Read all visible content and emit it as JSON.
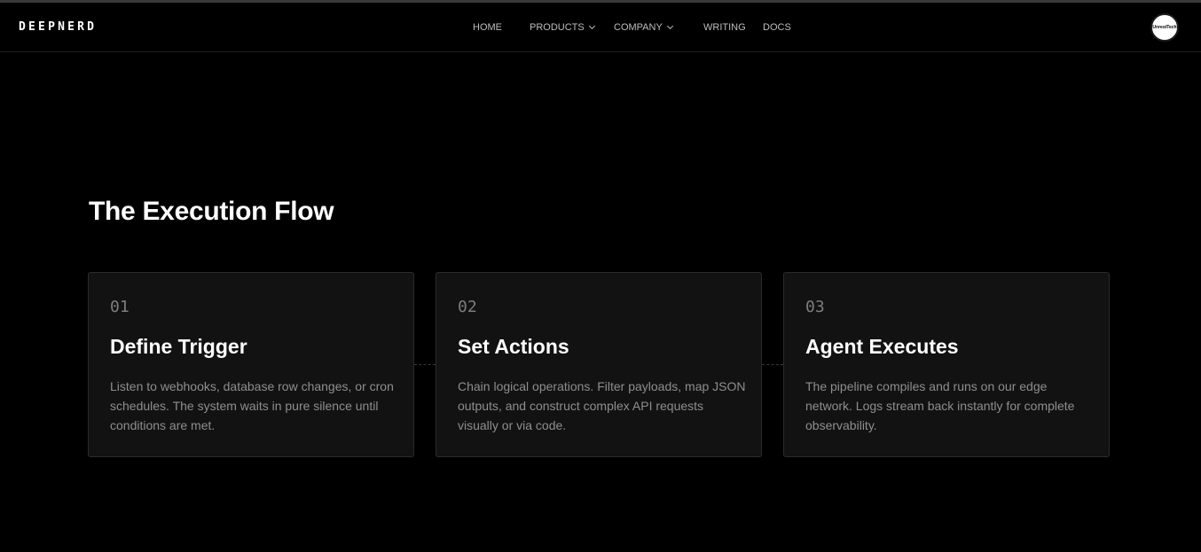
{
  "header": {
    "brand": "DEEPNERD",
    "nav": [
      {
        "label": "HOME",
        "has_dropdown": false
      },
      {
        "label": "PRODUCTS",
        "has_dropdown": true
      },
      {
        "label": "COMPANY",
        "has_dropdown": true
      },
      {
        "label": "WRITING",
        "has_dropdown": false
      },
      {
        "label": "DOCS",
        "has_dropdown": false
      }
    ],
    "avatar_text": "UnrestTech"
  },
  "section": {
    "title": "The Execution Flow",
    "steps": [
      {
        "number": "01",
        "title": "Define Trigger",
        "description": "Listen to webhooks, database row changes, or cron schedules. The system waits in pure silence until conditions are met."
      },
      {
        "number": "02",
        "title": "Set Actions",
        "description": "Chain logical operations. Filter payloads, map JSON outputs, and construct complex API requests visually or via code."
      },
      {
        "number": "03",
        "title": "Agent Executes",
        "description": "The pipeline compiles and runs on our edge network. Logs stream back instantly for complete observability."
      }
    ]
  },
  "colors": {
    "background": "#000000",
    "card_background": "#121212",
    "card_border": "#2b2b2b",
    "text_primary": "#ffffff",
    "text_muted": "#8e8e8e",
    "step_number": "#7d7d7d"
  }
}
